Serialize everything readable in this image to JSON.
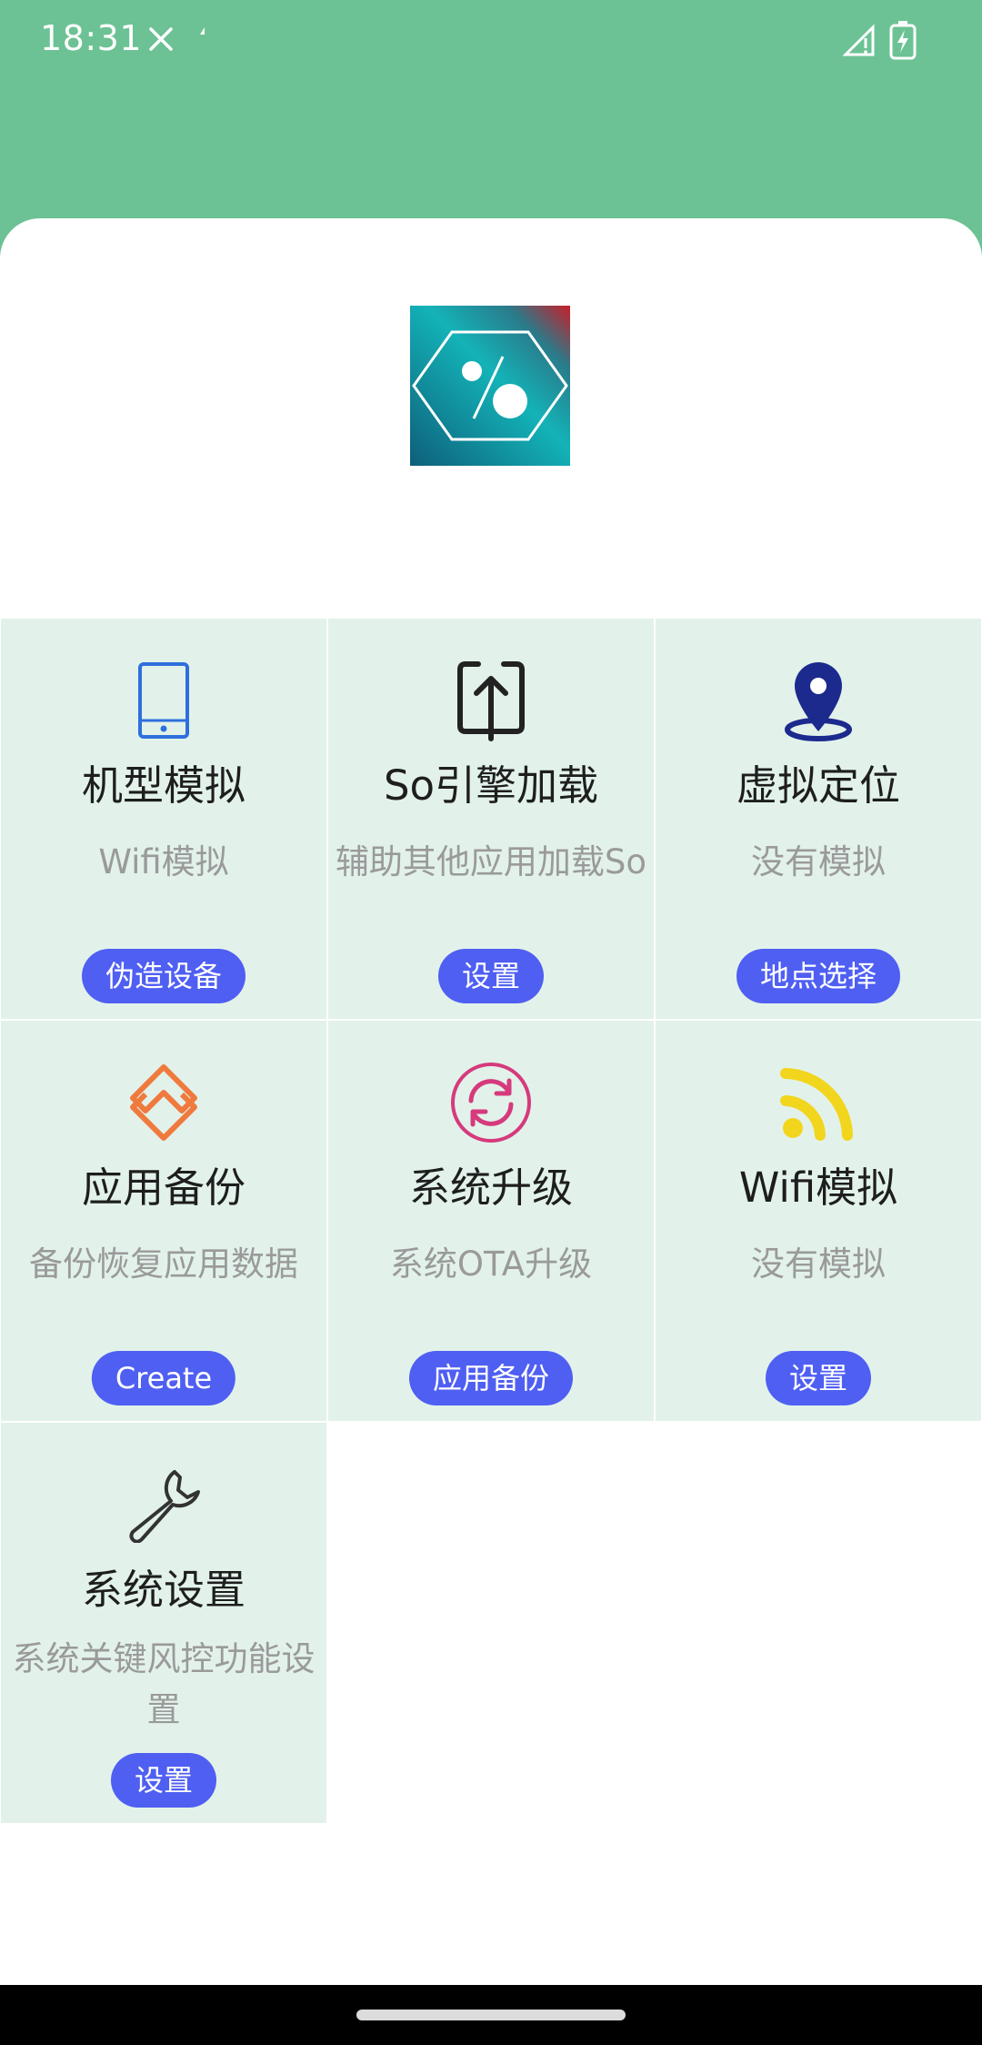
{
  "status_bar": {
    "time": "18:31"
  },
  "colors": {
    "header": "#6cc294",
    "cell_bg": "#e2f2ea",
    "button": "#4f5ff2",
    "title_text": "#1e1e1e",
    "subtitle_text": "#9a9a9a"
  },
  "features": [
    {
      "title": "机型模拟",
      "subtitle": "Wifi模拟",
      "button": "伪造设备",
      "icon": "phone-icon"
    },
    {
      "title": "So引擎加载",
      "subtitle": "辅助其他应用加载So",
      "button": "设置",
      "icon": "upload-icon"
    },
    {
      "title": "虚拟定位",
      "subtitle": "没有模拟",
      "button": "地点选择",
      "icon": "location-pin-icon"
    },
    {
      "title": "应用备份",
      "subtitle": "备份恢复应用数据",
      "button": "Create",
      "icon": "layers-icon"
    },
    {
      "title": "系统升级",
      "subtitle": "系统OTA升级",
      "button": "应用备份",
      "icon": "refresh-icon"
    },
    {
      "title": "Wifi模拟",
      "subtitle": "没有模拟",
      "button": "设置",
      "icon": "rss-icon"
    },
    {
      "title": "系统设置",
      "subtitle": "系统关键风控功能设置",
      "button": "设置",
      "icon": "wrench-icon"
    }
  ]
}
